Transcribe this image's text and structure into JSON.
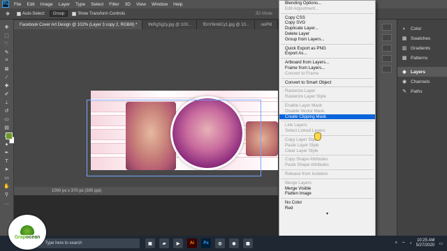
{
  "menubar": {
    "app_icon": "Ps",
    "items": [
      "File",
      "Edit",
      "Image",
      "Layer",
      "Type",
      "Select",
      "Filter",
      "3D",
      "View",
      "Window",
      "Help"
    ]
  },
  "options_bar": {
    "auto_select_label": "Auto-Select:",
    "auto_select_value": "Group",
    "transform_label": "Show Transform Controls",
    "mode_label": "3D Mode"
  },
  "tabs": [
    "Facebook Cover Art Design @ 102% (Layer 3 copy 2, RGB/8) *",
    "frkRgSg2y.jpg @ 100...",
    "fDnY6m6Cy1.jpg @ 10...",
    "ooPM"
  ],
  "status": {
    "doc_size": "1000 px x 370 px (300 ppi)"
  },
  "context_menu": {
    "groups": [
      [
        {
          "label": "Blending Options...",
          "disabled": false
        },
        {
          "label": "Edit Adjustment...",
          "disabled": true
        }
      ],
      [
        {
          "label": "Copy CSS",
          "disabled": false
        },
        {
          "label": "Copy SVG",
          "disabled": false
        },
        {
          "label": "Duplicate Layer...",
          "disabled": false
        },
        {
          "label": "Delete Layer",
          "disabled": false
        },
        {
          "label": "Group from Layers...",
          "disabled": false
        }
      ],
      [
        {
          "label": "Quick Export as PNG",
          "disabled": false
        },
        {
          "label": "Export As...",
          "disabled": false
        }
      ],
      [
        {
          "label": "Artboard from Layers...",
          "disabled": false
        },
        {
          "label": "Frame from Layers...",
          "disabled": false
        },
        {
          "label": "Convert to Frame",
          "disabled": true
        }
      ],
      [
        {
          "label": "Convert to Smart Object",
          "disabled": false
        }
      ],
      [
        {
          "label": "Rasterize Layer",
          "disabled": true
        },
        {
          "label": "Rasterize Layer Style",
          "disabled": true
        }
      ],
      [
        {
          "label": "Enable Layer Mask",
          "disabled": true
        },
        {
          "label": "Disable Vector Mask",
          "disabled": true
        },
        {
          "label": "Create Clipping Mask",
          "disabled": false,
          "highlighted": true
        }
      ],
      [
        {
          "label": "Link Layers",
          "disabled": true
        },
        {
          "label": "Select Linked Layers",
          "disabled": true
        }
      ],
      [
        {
          "label": "Copy Layer Style",
          "disabled": true
        },
        {
          "label": "Paste Layer Style",
          "disabled": true
        },
        {
          "label": "Clear Layer Style",
          "disabled": true
        }
      ],
      [
        {
          "label": "Copy Shape Attributes",
          "disabled": true
        },
        {
          "label": "Paste Shape Attributes",
          "disabled": true
        }
      ],
      [
        {
          "label": "Release from Isolation",
          "disabled": true
        }
      ],
      [
        {
          "label": "Merge Layers",
          "disabled": true
        },
        {
          "label": "Merge Visible",
          "disabled": false
        },
        {
          "label": "Flatten Image",
          "disabled": false
        }
      ],
      [
        {
          "label": "No Color",
          "disabled": false
        },
        {
          "label": "Red",
          "disabled": false
        }
      ]
    ]
  },
  "panels": [
    {
      "label": "Color",
      "icon": "color-icon",
      "active": false
    },
    {
      "label": "Swatches",
      "icon": "swatches-icon",
      "active": false
    },
    {
      "label": "Gradients",
      "icon": "gradients-icon",
      "active": false
    },
    {
      "label": "Patterns",
      "icon": "patterns-icon",
      "active": false
    },
    {
      "label": "Layers",
      "icon": "layers-icon",
      "active": true
    },
    {
      "label": "Channels",
      "icon": "channels-icon",
      "active": false
    },
    {
      "label": "Paths",
      "icon": "paths-icon",
      "active": false
    }
  ],
  "taskbar": {
    "search_placeholder": "Type here to search",
    "time": "10:25 AM",
    "date": "5/27/2020",
    "apps": [
      {
        "name": "Ai",
        "color": "#ff9a00"
      },
      {
        "name": "Ps",
        "color": "#31a8ff"
      }
    ]
  },
  "watermark": {
    "brand_a": "Grap",
    "brand_b": "ocean"
  },
  "colors": {
    "foreground": "#6a9a28",
    "background": "#ffffff",
    "menu_highlight": "#0a64d9"
  }
}
